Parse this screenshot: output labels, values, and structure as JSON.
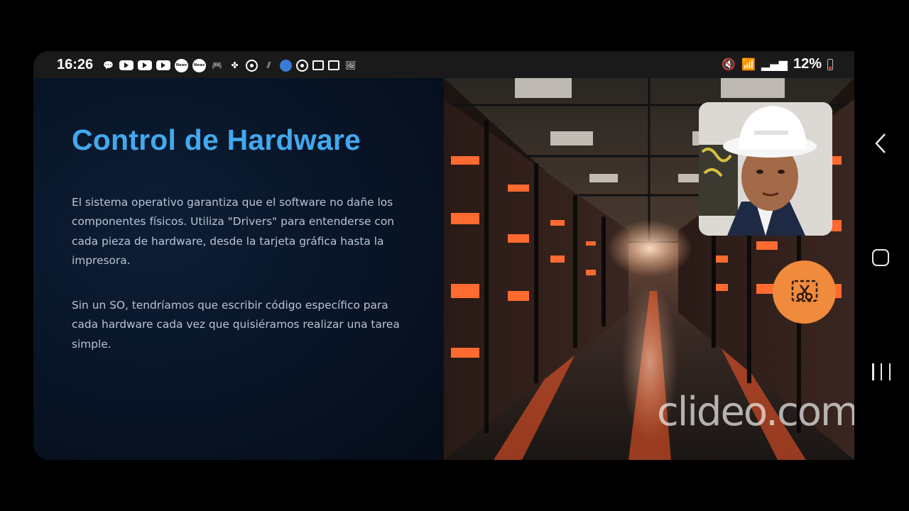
{
  "status_bar": {
    "time": "16:26",
    "notification_icons": [
      "chat-bubble-icon",
      "youtube-icon",
      "youtube-icon",
      "youtube-icon",
      "news-icon",
      "news-icon",
      "discord-icon",
      "pinwheel-icon",
      "pokeball-icon",
      "stripes-icon",
      "blue-app-icon",
      "pokeball-icon",
      "screenshot-icon",
      "screenshot-icon",
      "gallery-icon"
    ],
    "news_label": "News",
    "mute_glyph": "🔇",
    "wifi_glyph": "📶",
    "signal_glyph": "▂▄▆",
    "battery_percent": "12%",
    "battery_level": 0.12
  },
  "slide": {
    "title": "Control de Hardware",
    "paragraph1": "El sistema operativo garantiza que el software no dañe los componentes físicos. Utiliza \"Drivers\" para entenderse con cada pieza de hardware, desde la tarjeta gráfica hasta la impresora.",
    "paragraph2": "Sin un SO, tendríamos que escribir código específico para cada hardware cada vez que quisiéramos realizar una tarea simple.",
    "title_color": "#43a8ee",
    "image_subject": "server-room-photo"
  },
  "overlay": {
    "webcam_subject": "person-with-white-hard-hat",
    "record_button_icon": "screen-record-scissors-icon",
    "record_button_color": "#f08a3c",
    "watermark": "clideo.com"
  },
  "navigation": {
    "back": "back-icon",
    "home": "home-icon",
    "recents": "recents-icon"
  }
}
